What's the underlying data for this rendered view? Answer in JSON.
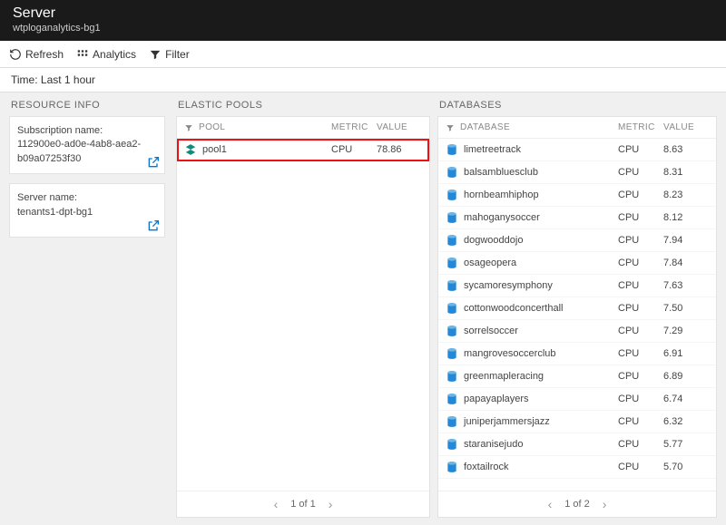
{
  "header": {
    "title": "Server",
    "subtitle": "wtploganalytics-bg1"
  },
  "toolbar": {
    "refresh": "Refresh",
    "analytics": "Analytics",
    "filter": "Filter"
  },
  "time_bar": "Time: Last 1 hour",
  "resource_info": {
    "header": "RESOURCE INFO",
    "tiles": [
      {
        "label": "Subscription name:",
        "value": "112900e0-ad0e-4ab8-aea2-b09a07253f30"
      },
      {
        "label": "Server name:",
        "value": "tenants1-dpt-bg1"
      }
    ]
  },
  "pools": {
    "header": "ELASTIC POOLS",
    "cols": {
      "name": "POOL",
      "metric": "METRIC",
      "value": "VALUE"
    },
    "rows": [
      {
        "name": "pool1",
        "metric": "CPU",
        "value": "78.86",
        "highlight": true
      }
    ],
    "pager": "1 of 1"
  },
  "databases": {
    "header": "DATABASES",
    "cols": {
      "name": "DATABASE",
      "metric": "METRIC",
      "value": "VALUE"
    },
    "rows": [
      {
        "name": "limetreetrack",
        "metric": "CPU",
        "value": "8.63"
      },
      {
        "name": "balsambluesclub",
        "metric": "CPU",
        "value": "8.31"
      },
      {
        "name": "hornbeamhiphop",
        "metric": "CPU",
        "value": "8.23"
      },
      {
        "name": "mahoganysoccer",
        "metric": "CPU",
        "value": "8.12"
      },
      {
        "name": "dogwooddojo",
        "metric": "CPU",
        "value": "7.94"
      },
      {
        "name": "osageopera",
        "metric": "CPU",
        "value": "7.84"
      },
      {
        "name": "sycamoresymphony",
        "metric": "CPU",
        "value": "7.63"
      },
      {
        "name": "cottonwoodconcerthall",
        "metric": "CPU",
        "value": "7.50"
      },
      {
        "name": "sorrelsoccer",
        "metric": "CPU",
        "value": "7.29"
      },
      {
        "name": "mangrovesoccerclub",
        "metric": "CPU",
        "value": "6.91"
      },
      {
        "name": "greenmapleracing",
        "metric": "CPU",
        "value": "6.89"
      },
      {
        "name": "papayaplayers",
        "metric": "CPU",
        "value": "6.74"
      },
      {
        "name": "juniperjammersjazz",
        "metric": "CPU",
        "value": "6.32"
      },
      {
        "name": "staranisejudo",
        "metric": "CPU",
        "value": "5.77"
      },
      {
        "name": "foxtailrock",
        "metric": "CPU",
        "value": "5.70"
      }
    ],
    "pager": "1 of 2"
  }
}
